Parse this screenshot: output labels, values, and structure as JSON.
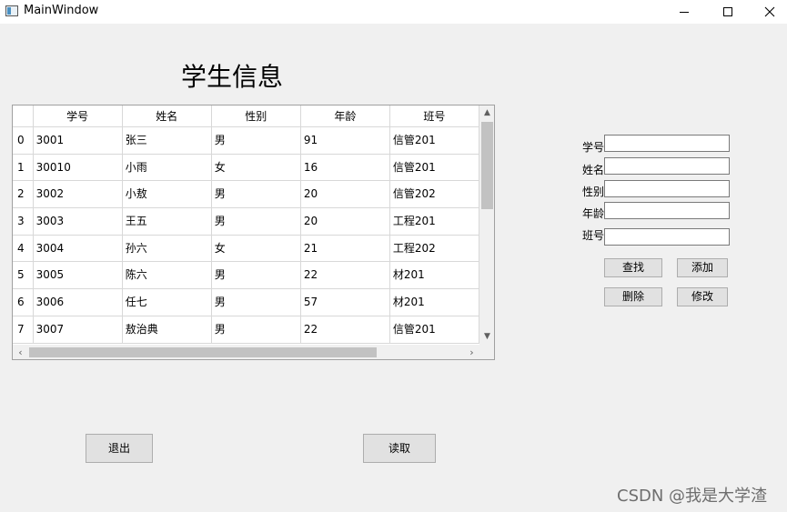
{
  "window": {
    "title": "MainWindow",
    "controls": [
      "minimize-icon",
      "maximize-icon",
      "close-icon"
    ]
  },
  "heading": "学生信息",
  "table": {
    "columns": [
      "学号",
      "姓名",
      "性别",
      "年龄",
      "班号"
    ],
    "rows": [
      {
        "index": "0",
        "cells": [
          "3001",
          "张三",
          "男",
          "91",
          "信管201"
        ]
      },
      {
        "index": "1",
        "cells": [
          "30010",
          "小雨",
          "女",
          "16",
          "信管201"
        ]
      },
      {
        "index": "2",
        "cells": [
          "3002",
          "小敖",
          "男",
          "20",
          "信管202"
        ]
      },
      {
        "index": "3",
        "cells": [
          "3003",
          "王五",
          "男",
          "20",
          "工程201"
        ]
      },
      {
        "index": "4",
        "cells": [
          "3004",
          "孙六",
          "女",
          "21",
          "工程202"
        ]
      },
      {
        "index": "5",
        "cells": [
          "3005",
          "陈六",
          "男",
          "22",
          "材201"
        ]
      },
      {
        "index": "6",
        "cells": [
          "3006",
          "任七",
          "男",
          "57",
          "材201"
        ]
      },
      {
        "index": "7",
        "cells": [
          "3007",
          "敖治典",
          "男",
          "22",
          "信管201"
        ]
      }
    ],
    "scroll_arrows": {
      "up": "▲",
      "down": "▼",
      "left": "‹",
      "right": "›"
    }
  },
  "form": {
    "labels": {
      "id": "学号",
      "name": "姓名",
      "gender": "性别",
      "age": "年龄",
      "class": "班号"
    },
    "values": {
      "id": "",
      "name": "",
      "gender": "",
      "age": "",
      "class": ""
    }
  },
  "buttons": {
    "search": "查找",
    "add": "添加",
    "delete": "删除",
    "modify": "修改",
    "exit": "退出",
    "read": "读取"
  },
  "watermark": "CSDN @我是大学渣"
}
